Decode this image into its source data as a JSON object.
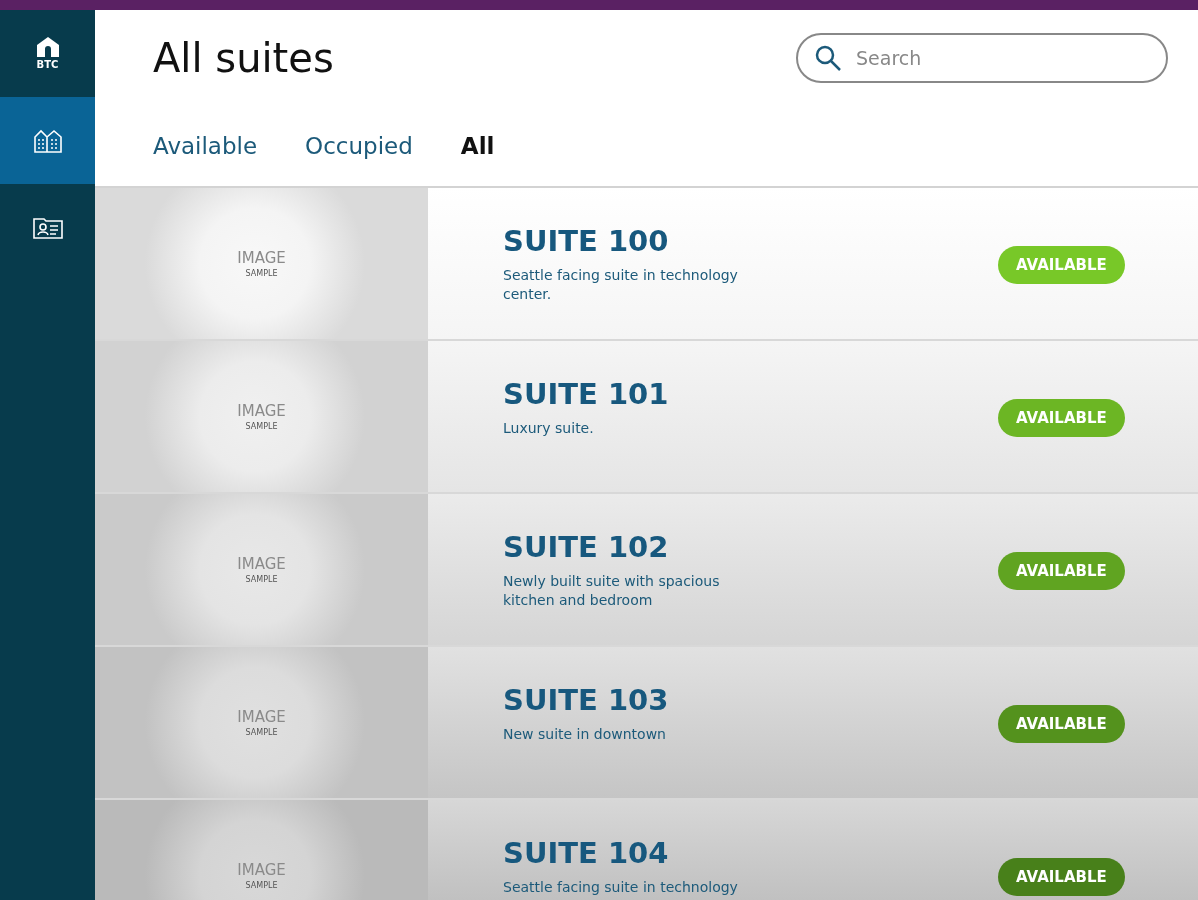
{
  "sidebar": {
    "logo_label": "BTC",
    "items": [
      {
        "kind": "buildings",
        "selected": true
      },
      {
        "kind": "contact-card",
        "selected": false
      }
    ]
  },
  "header": {
    "title": "All suites",
    "search": {
      "placeholder": "Search"
    },
    "tabs": [
      {
        "label": "Available",
        "selected": false
      },
      {
        "label": "Occupied",
        "selected": false
      },
      {
        "label": "All",
        "selected": true
      }
    ]
  },
  "suites": [
    {
      "image_label": "IMAGE",
      "image_sublabel": "SAMPLE",
      "name": "SUITE 100",
      "description": "Seattle facing suite in technology center.",
      "status": "AVAILABLE"
    },
    {
      "image_label": "IMAGE",
      "image_sublabel": "SAMPLE",
      "name": "SUITE 101",
      "description": "Luxury suite.",
      "status": "AVAILABLE"
    },
    {
      "image_label": "IMAGE",
      "image_sublabel": "SAMPLE",
      "name": "SUITE 102",
      "description": "Newly built suite with spacious kitchen and bedroom",
      "status": "AVAILABLE"
    },
    {
      "image_label": "IMAGE",
      "image_sublabel": "SAMPLE",
      "name": "SUITE 103",
      "description": "New suite in downtown",
      "status": "AVAILABLE"
    },
    {
      "image_label": "IMAGE",
      "image_sublabel": "SAMPLE",
      "name": "SUITE 104",
      "description": "Seattle facing suite in technology",
      "status": "AVAILABLE"
    }
  ]
}
